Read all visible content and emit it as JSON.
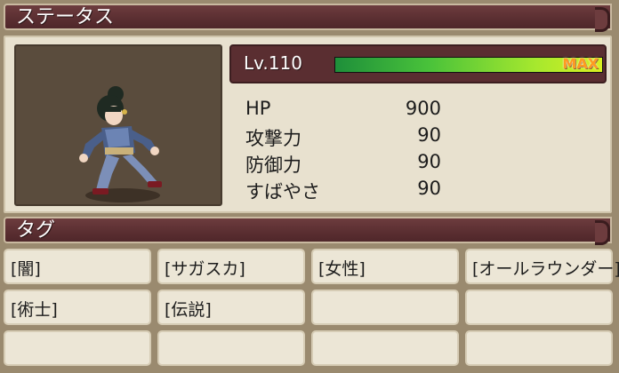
{
  "status_header": {
    "title": "ステータス"
  },
  "level": {
    "label": "Lv.110",
    "exp_fraction": 1.0,
    "max_label": "MAX"
  },
  "stats": [
    {
      "label": "HP",
      "value": "900"
    },
    {
      "label": "攻撃力",
      "value": "90"
    },
    {
      "label": "防御力",
      "value": "90"
    },
    {
      "label": "すばやさ",
      "value": "90"
    }
  ],
  "tag_header": {
    "title": "タグ"
  },
  "tags": [
    "[闇]",
    "[サガスカ]",
    "[女性]",
    "[オールラウンダー]",
    "[術士]",
    "[伝説]",
    "",
    "",
    "",
    "",
    "",
    ""
  ],
  "colors": {
    "header": "#5a2e31",
    "panel": "#e8e1cf",
    "max": "#ff9a20"
  }
}
